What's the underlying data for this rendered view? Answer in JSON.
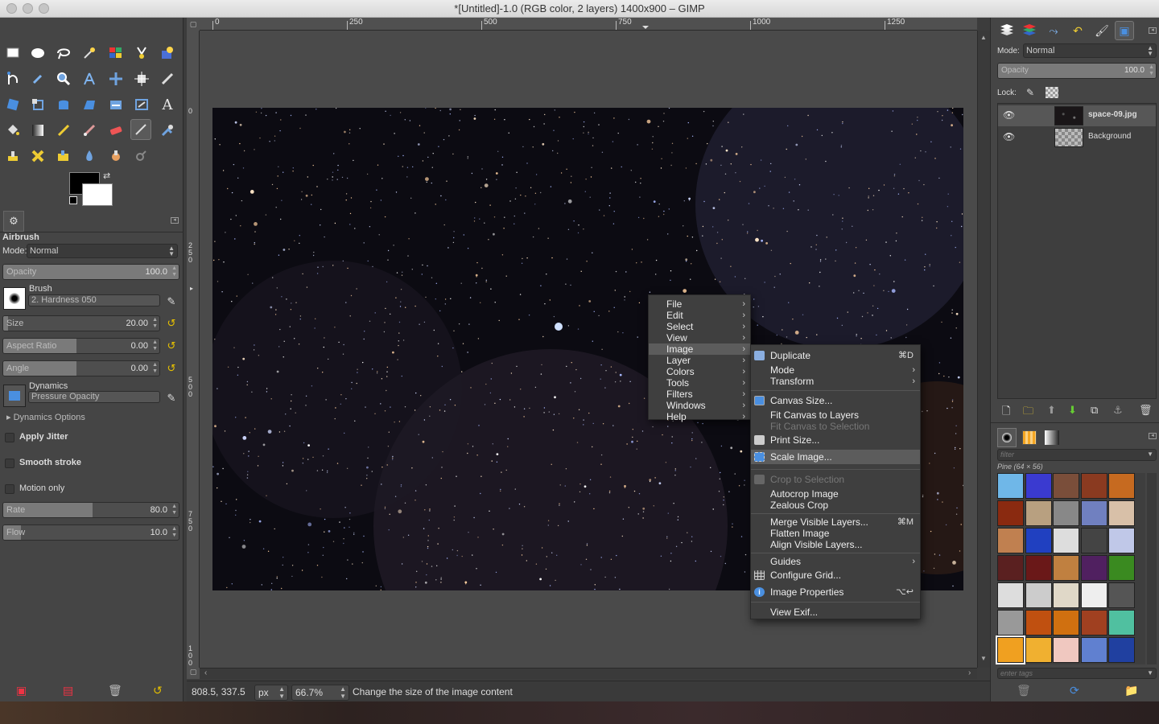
{
  "window": {
    "title": "*[Untitled]-1.0 (RGB color, 2 layers) 1400x900 – GIMP"
  },
  "toolbox": {
    "tool_icons": [
      "rect-select",
      "ellipse-select",
      "free-select",
      "fuzzy-select",
      "select-by-color",
      "scissors-select",
      "foreground-select",
      "paths",
      "color-picker",
      "zoom",
      "measure",
      "move",
      "align",
      "crop",
      "unified-transform",
      "rotate",
      "scale",
      "shear",
      "perspective",
      "flip",
      "text",
      "bucket-fill",
      "blend",
      "pencil",
      "paintbrush",
      "eraser",
      "airbrush",
      "ink",
      "clone",
      "heal",
      "perspective-clone",
      "blur",
      "smudge",
      "dodge-burn"
    ],
    "fg_color": "#000000",
    "bg_color": "#ffffff"
  },
  "tool_options": {
    "tool_name": "Airbrush",
    "mode_label": "Mode:",
    "mode_value": "Normal",
    "opacity_label": "Opacity",
    "opacity_value": "100.0",
    "brush_label": "Brush",
    "brush_value": "2. Hardness 050",
    "size_label": "Size",
    "size_value": "20.00",
    "aspect_label": "Aspect Ratio",
    "aspect_value": "0.00",
    "angle_label": "Angle",
    "angle_value": "0.00",
    "dynamics_label": "Dynamics",
    "dynamics_value": "Pressure Opacity",
    "dynamics_options": "Dynamics Options",
    "apply_jitter": "Apply Jitter",
    "smooth_stroke": "Smooth stroke",
    "motion_only": "Motion only",
    "rate_label": "Rate",
    "rate_value": "80.0",
    "flow_label": "Flow",
    "flow_value": "10.0"
  },
  "ruler": {
    "h_ticks": [
      "0",
      "250",
      "500",
      "750",
      "1000",
      "1250"
    ],
    "v_ticks": [
      "0",
      "250",
      "500",
      "750",
      "100"
    ]
  },
  "statusbar": {
    "coords": "808.5, 337.5",
    "unit": "px",
    "zoom": "66.7%",
    "message": "Change the size of the image content"
  },
  "image_menu": {
    "items": [
      "File",
      "Edit",
      "Select",
      "View",
      "Image",
      "Layer",
      "Colors",
      "Tools",
      "Filters",
      "Windows",
      "Help"
    ],
    "selected": "Image"
  },
  "image_submenu": {
    "duplicate": "Duplicate",
    "duplicate_sc": "⌘D",
    "mode": "Mode",
    "transform": "Transform",
    "canvas_size": "Canvas Size...",
    "fit_canvas_layers": "Fit Canvas to Layers",
    "fit_canvas_selection": "Fit Canvas to Selection",
    "print_size": "Print Size...",
    "scale_image": "Scale Image...",
    "crop_selection": "Crop to Selection",
    "autocrop": "Autocrop Image",
    "zealous": "Zealous Crop",
    "merge_visible": "Merge Visible Layers...",
    "merge_sc": "⌘M",
    "flatten": "Flatten Image",
    "align_visible": "Align Visible Layers...",
    "guides": "Guides",
    "configure_grid": "Configure Grid...",
    "image_props": "Image Properties",
    "image_props_sc": "⌥↩",
    "view_exif": "View Exif..."
  },
  "layers": {
    "mode_label": "Mode:",
    "mode_value": "Normal",
    "opacity_label": "Opacity",
    "opacity_value": "100.0",
    "lock_label": "Lock:",
    "items": [
      {
        "name": "space-09.jpg"
      },
      {
        "name": "Background"
      }
    ]
  },
  "patterns": {
    "filter_placeholder": "filter",
    "selected_name": "Pine (64 × 56)",
    "tags_placeholder": "enter tags"
  }
}
